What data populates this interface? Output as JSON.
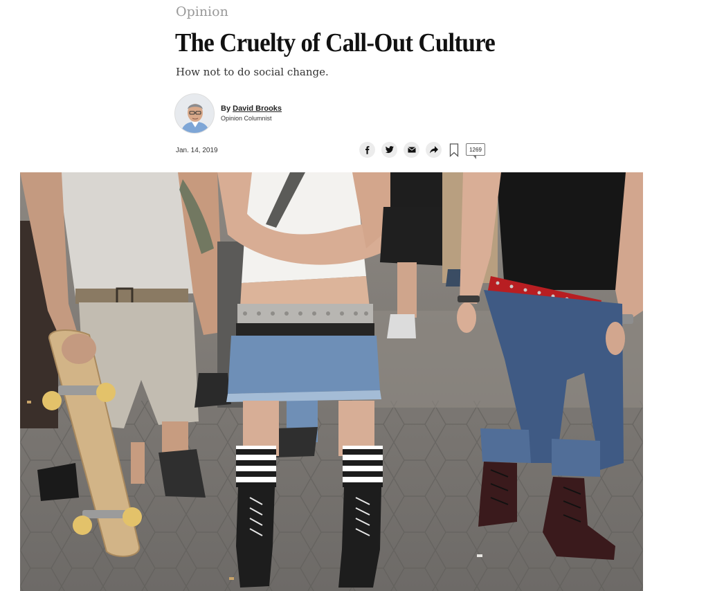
{
  "article": {
    "section": "Opinion",
    "headline": "The Cruelty of Call-Out Culture",
    "summary": "How not to do social change.",
    "byline": {
      "prefix": "By ",
      "author": "David Brooks",
      "role": "Opinion Columnist"
    },
    "date": "Jan. 14, 2019"
  },
  "share": {
    "icons": [
      "facebook-icon",
      "twitter-icon",
      "email-icon",
      "share-icon",
      "bookmark-icon"
    ],
    "comment_count": "1269"
  },
  "hero_image": {
    "alt": "Group of people in punk clothing standing on pavement, one holding a skateboard"
  },
  "colors": {
    "section_gray": "#999999",
    "headline": "#111111",
    "share_bg": "#ececec"
  }
}
